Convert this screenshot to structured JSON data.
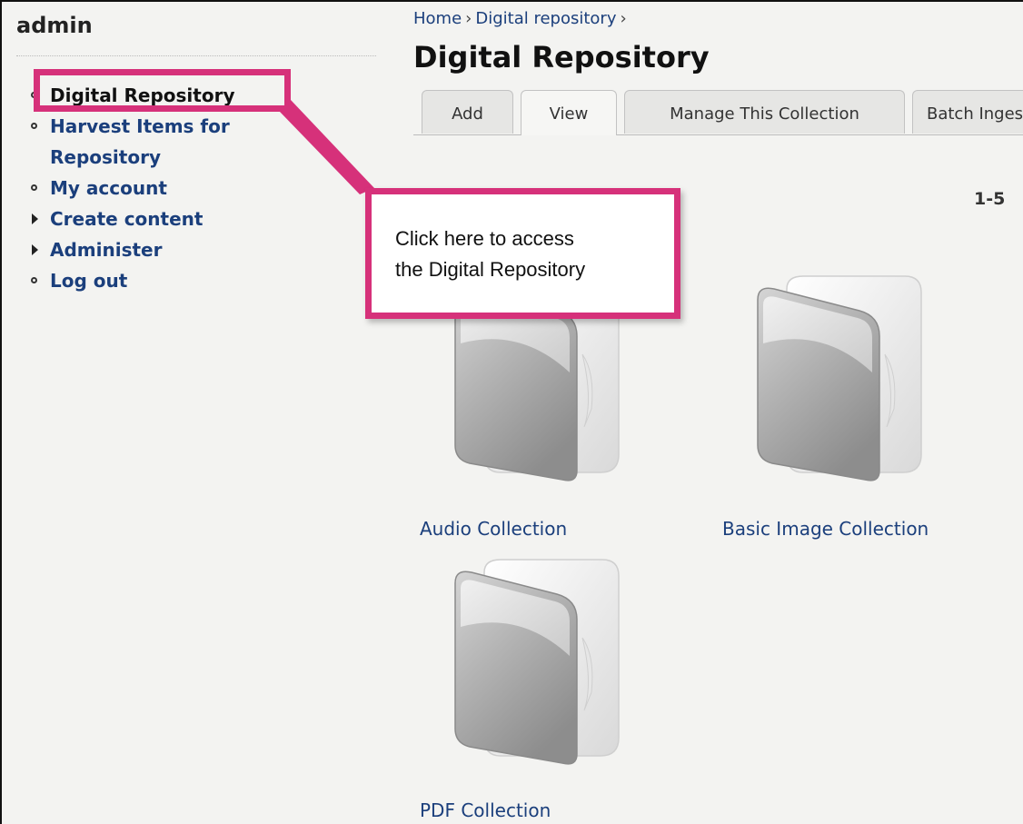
{
  "sidebar": {
    "title": "admin",
    "items": [
      {
        "label": "Digital Repository",
        "marker": "circle"
      },
      {
        "label": "Harvest Items for",
        "label2": "Repository",
        "marker": "circle"
      },
      {
        "label": "My account",
        "marker": "circle"
      },
      {
        "label": "Create content",
        "marker": "triangle"
      },
      {
        "label": "Administer",
        "marker": "triangle"
      },
      {
        "label": "Log out",
        "marker": "circle"
      }
    ]
  },
  "breadcrumb": {
    "home": "Home",
    "sep": "›",
    "repo": "Digital repository"
  },
  "page_title": "Digital Repository",
  "tabs": [
    {
      "label": "Add"
    },
    {
      "label": "View",
      "active": true
    },
    {
      "label": "Manage This Collection"
    },
    {
      "label": "Batch Ingest"
    }
  ],
  "pager": "1-5",
  "collections": [
    {
      "label": "Audio Collection",
      "icon": "folder-icon"
    },
    {
      "label": "Basic Image Collection",
      "icon": "folder-icon"
    },
    {
      "label": "PDF Collection",
      "icon": "folder-icon"
    }
  ],
  "callout": {
    "line1": "Click here to access",
    "line2": "the Digital Repository"
  },
  "colors": {
    "highlight": "#d6317a",
    "link": "#1b3f7c"
  }
}
